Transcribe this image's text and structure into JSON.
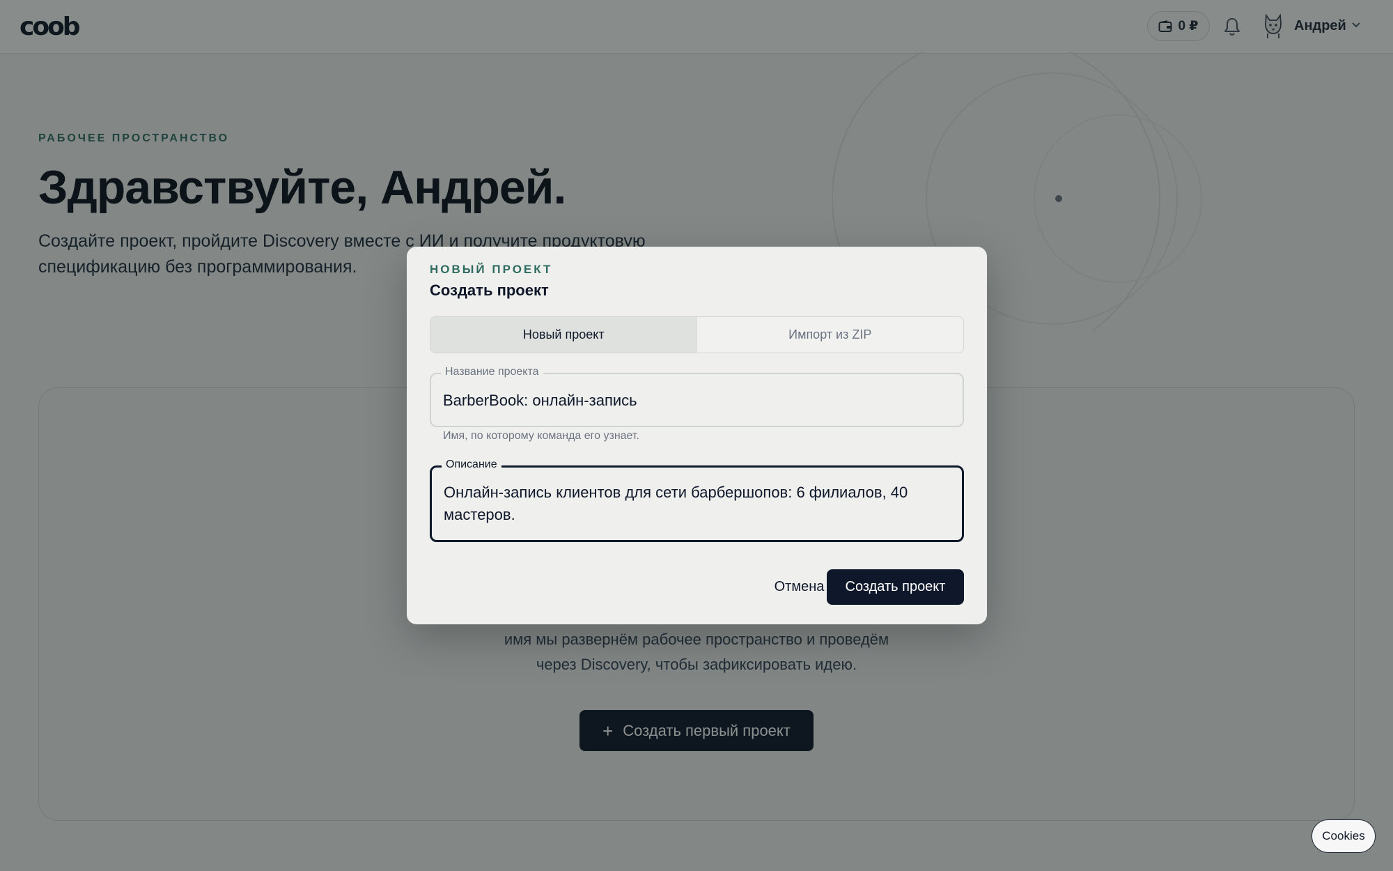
{
  "header": {
    "logo": "coob",
    "balance": "0 ₽",
    "user_name": "Андрей"
  },
  "main": {
    "eyebrow": "РАБОЧЕЕ ПРОСТРАНСТВО",
    "greeting": "Здравствуйте, Андрей.",
    "intro": "Создайте проект, пройдите Discovery вместе с ИИ и получите продуктовую спецификацию без программирования.",
    "empty_state": {
      "line_1": "имя мы развернём рабочее пространство и проведём",
      "line_2": "через Discovery, чтобы зафиксировать идею.",
      "button_label": "Создать первый проект"
    }
  },
  "modal": {
    "eyebrow": "НОВЫЙ ПРОЕКТ",
    "title": "Создать проект",
    "tabs": [
      {
        "label": "Новый проект",
        "active": true
      },
      {
        "label": "Импорт из ZIP",
        "active": false
      }
    ],
    "name_field": {
      "label": "Название проекта",
      "value": "BarberBook: онлайн-запись",
      "hint": "Имя, по которому команда его узнает."
    },
    "description_field": {
      "label": "Описание",
      "value": "Онлайн-запись клиентов для сети барбершопов: 6 филиалов, 40 мастеров."
    },
    "cancel_label": "Отмена",
    "submit_label": "Создать проект"
  },
  "cookies_label": "Cookies",
  "colors": {
    "accent": "#2f6b60",
    "primary": "#0f172a",
    "background": "#eef0ee"
  }
}
